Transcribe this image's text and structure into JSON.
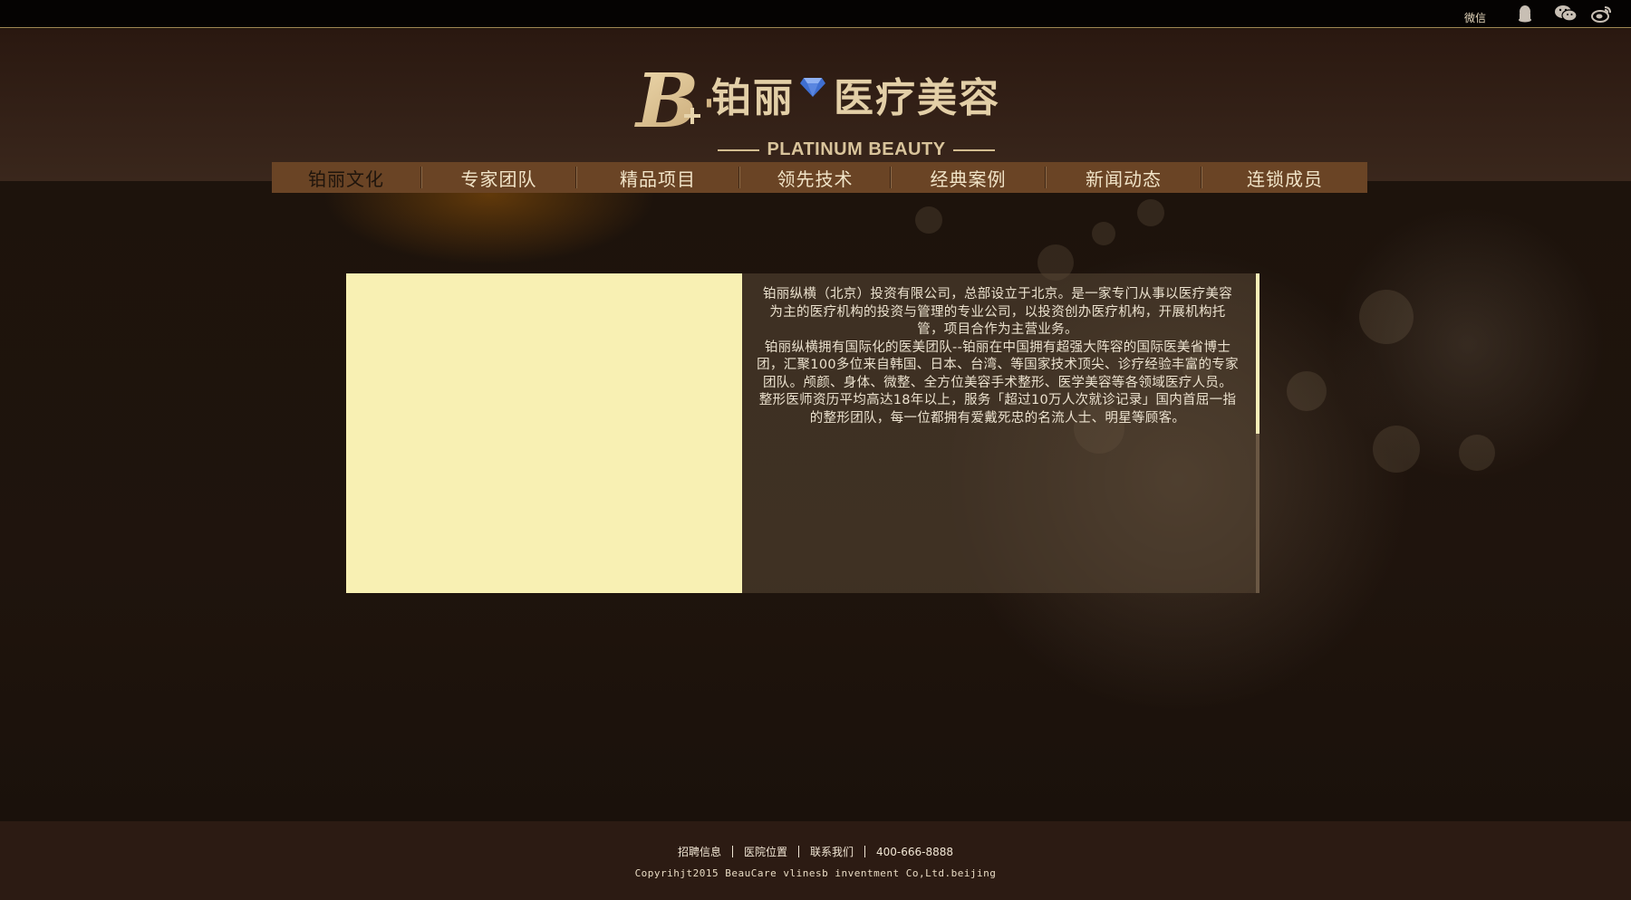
{
  "topbar": {
    "wechat_label": "微信",
    "icons": [
      "qq-icon",
      "wechat-icon",
      "weibo-icon"
    ]
  },
  "logo": {
    "mark": "B+",
    "cn_left": "铂丽",
    "cn_right": "医疗美容",
    "en": "PLATINUM BEAUTY"
  },
  "nav": {
    "items": [
      {
        "label": "铂丽文化",
        "active": true
      },
      {
        "label": "专家团队"
      },
      {
        "label": "精品项目"
      },
      {
        "label": "领先技术"
      },
      {
        "label": "经典案例"
      },
      {
        "label": "新闻动态"
      },
      {
        "label": "连锁成员"
      }
    ]
  },
  "intro": {
    "paragraph1": "铂丽纵横（北京）投资有限公司，总部设立于北京。是一家专门从事以医疗美容为主的医疗机构的投资与管理的专业公司，以投资创办医疗机构，开展机构托管，项目合作为主营业务。",
    "paragraph2": "铂丽纵横拥有国际化的医美团队--铂丽在中国拥有超强大阵容的国际医美省博士团，汇聚100多位来自韩国、日本、台湾、等国家技术顶尖、诊疗经验丰富的专家团队。颅颜、身体、微整、全方位美容手术整形、医学美容等各领域医疗人员。整形医师资历平均高达18年以上，服务「超过10万人次就诊记录」国内首屈一指的整形团队，每一位都拥有爱戴死忠的名流人士、明星等顾客。"
  },
  "footer": {
    "links": [
      "招聘信息",
      "医院位置",
      "联系我们",
      "400-666-8888"
    ],
    "copyright": "Copyrihjt2015 BeauCare vlinesb inventment Co,Ltd.beijing"
  },
  "colors": {
    "accent": "#6a4425",
    "gold": "#e3cfa7",
    "image_placeholder": "#f8f0b3"
  }
}
